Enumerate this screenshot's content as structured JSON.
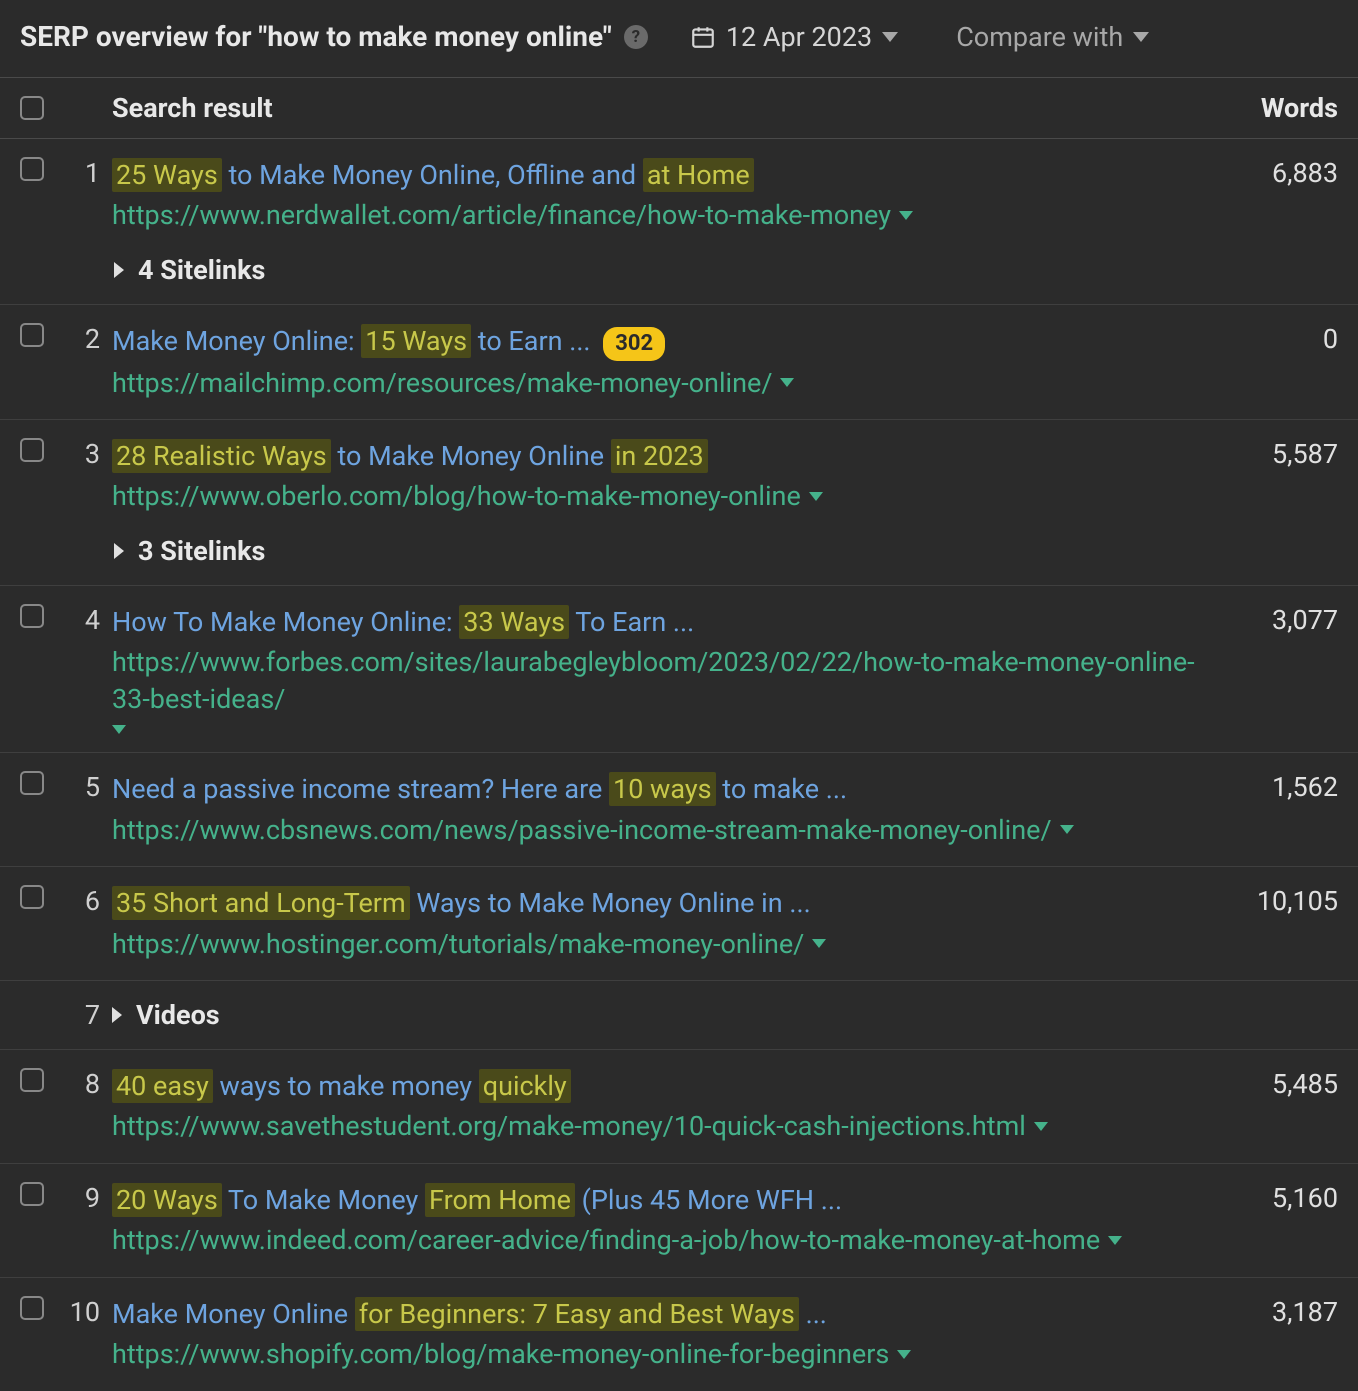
{
  "header": {
    "title": "SERP overview for \"how to make money online\"",
    "date": "12 Apr 2023",
    "compare_label": "Compare with"
  },
  "columns": {
    "result": "Search result",
    "words": "Words"
  },
  "labels": {
    "sitelinks_4": "4 Sitelinks",
    "sitelinks_3": "3 Sitelinks",
    "videos": "Videos"
  },
  "results": [
    {
      "rank": "1",
      "title_parts": [
        {
          "text": "25 Ways",
          "hl": true
        },
        {
          "text": " to Make Money Online, Offline and ",
          "hl": false
        },
        {
          "text": "at Home",
          "hl": true
        }
      ],
      "url": "https://www.nerdwallet.com/article/finance/how-to-make-money",
      "words": "6,883",
      "sitelinks": "sitelinks_4"
    },
    {
      "rank": "2",
      "title_parts": [
        {
          "text": "Make Money Online: ",
          "hl": false
        },
        {
          "text": "15 Ways",
          "hl": true
        },
        {
          "text": " to Earn ...",
          "hl": false
        }
      ],
      "badge": "302",
      "url": "https://mailchimp.com/resources/make-money-online/",
      "words": "0"
    },
    {
      "rank": "3",
      "title_parts": [
        {
          "text": "28 Realistic Ways",
          "hl": true
        },
        {
          "text": " to Make Money Online ",
          "hl": false
        },
        {
          "text": "in 2023",
          "hl": true
        }
      ],
      "url": "https://www.oberlo.com/blog/how-to-make-money-online",
      "words": "5,587",
      "sitelinks": "sitelinks_3"
    },
    {
      "rank": "4",
      "title_parts": [
        {
          "text": "How To Make Money Online: ",
          "hl": false
        },
        {
          "text": "33 Ways",
          "hl": true
        },
        {
          "text": " To Earn ...",
          "hl": false
        }
      ],
      "url": "https://www.forbes.com/sites/laurabegleybloom/2023/02/22/how-to-make-money-online-33-best-ideas/",
      "words": "3,077"
    },
    {
      "rank": "5",
      "title_parts": [
        {
          "text": "Need a passive income stream? Here are ",
          "hl": false
        },
        {
          "text": "10 ways",
          "hl": true
        },
        {
          "text": " to make ...",
          "hl": false
        }
      ],
      "url": "https://www.cbsnews.com/news/passive-income-stream-make-money-online/",
      "words": "1,562"
    },
    {
      "rank": "6",
      "title_parts": [
        {
          "text": "35 Short and Long-Term",
          "hl": true
        },
        {
          "text": " Ways to Make Money Online in ...",
          "hl": false
        }
      ],
      "url": "https://www.hostinger.com/tutorials/make-money-online/",
      "words": "10,105"
    },
    {
      "rank": "7",
      "videos": true
    },
    {
      "rank": "8",
      "title_parts": [
        {
          "text": "40 easy",
          "hl": true
        },
        {
          "text": " ways to make money ",
          "hl": false
        },
        {
          "text": "quickly",
          "hl": true
        }
      ],
      "url": "https://www.savethestudent.org/make-money/10-quick-cash-injections.html",
      "words": "5,485"
    },
    {
      "rank": "9",
      "title_parts": [
        {
          "text": "20 Ways",
          "hl": true
        },
        {
          "text": " To Make Money ",
          "hl": false
        },
        {
          "text": "From Home",
          "hl": true
        },
        {
          "text": " (Plus 45 More WFH ...",
          "hl": false
        }
      ],
      "url": "https://www.indeed.com/career-advice/finding-a-job/how-to-make-money-at-home",
      "words": "5,160"
    },
    {
      "rank": "10",
      "title_parts": [
        {
          "text": "Make Money Online ",
          "hl": false
        },
        {
          "text": "for Beginners: 7 Easy and Best Ways",
          "hl": true
        },
        {
          "text": " ...",
          "hl": false
        }
      ],
      "url": "https://www.shopify.com/blog/make-money-online-for-beginners",
      "words": "3,187"
    }
  ]
}
